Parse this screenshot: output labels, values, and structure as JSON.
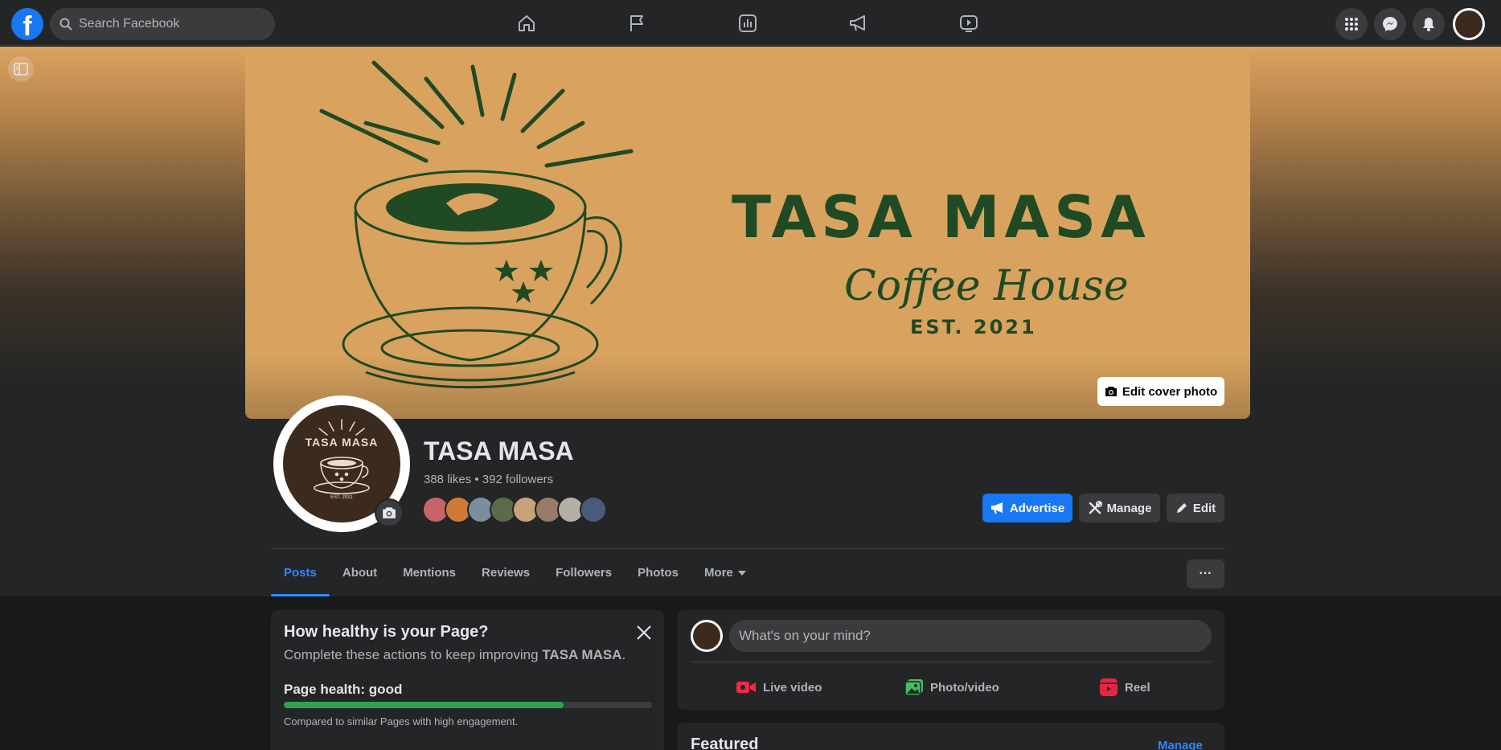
{
  "topbar": {
    "logo": "f",
    "search_placeholder": "Search Facebook",
    "nav_icons": [
      "home-icon",
      "flag-icon",
      "insights-icon",
      "megaphone-icon",
      "video-icon"
    ],
    "right_icons": [
      "grid-menu-icon",
      "messenger-icon",
      "bell-icon"
    ]
  },
  "cover": {
    "title": "TASA MASA",
    "subtitle": "Coffee House",
    "est": "EST. 2021",
    "edit_label": "Edit cover photo"
  },
  "profile": {
    "logo_title": "TASA MASA",
    "logo_est": "EST. 2021",
    "name": "TASA MASA",
    "stats": "388 likes • 392 followers",
    "follower_avatar_colors": [
      "#c9636a",
      "#d07a3a",
      "#7a8f9c",
      "#5b6b4a",
      "#c8a27a",
      "#9a7b6a",
      "#b5b0a5",
      "#4a5a7a"
    ]
  },
  "actions": {
    "advertise": "Advertise",
    "manage": "Manage",
    "edit": "Edit"
  },
  "tabs": [
    {
      "label": "Posts",
      "active": true
    },
    {
      "label": "About"
    },
    {
      "label": "Mentions"
    },
    {
      "label": "Reviews"
    },
    {
      "label": "Followers"
    },
    {
      "label": "Photos"
    },
    {
      "label": "More"
    }
  ],
  "more_dots": "···",
  "health": {
    "title": "How healthy is your Page?",
    "subtitle_prefix": "Complete these actions to keep improving ",
    "subtitle_page": "TASA MASA",
    "subtitle_suffix": ".",
    "label": "Page health: good",
    "level": 0.76,
    "note": "Compared to similar Pages with high engagement."
  },
  "composer": {
    "placeholder": "What's on your mind?",
    "live": "Live video",
    "photo": "Photo/video",
    "reel": "Reel"
  },
  "featured": {
    "title": "Featured",
    "manage": "Manage"
  },
  "colors": {
    "accent": "#1877f2",
    "link": "#2d88ff",
    "health_good": "#31a24c",
    "cover_bg": "#d9a35f",
    "cover_ink": "#1f4a23"
  }
}
